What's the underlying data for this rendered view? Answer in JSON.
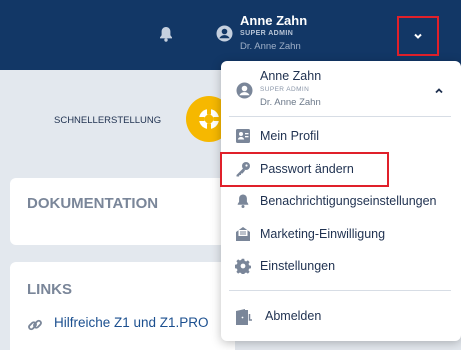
{
  "header": {
    "user_name": "Anne Zahn",
    "user_role": "SUPER ADMIN",
    "user_org": "Dr. Anne Zahn"
  },
  "quick_setup": {
    "label": "SCHNELLERSTELLUNG"
  },
  "cards": {
    "documentation_title": "DOKUMENTATION",
    "links_title": "LINKS",
    "links": [
      "Hilfreiche Z1 und Z1.PRO"
    ]
  },
  "menu": {
    "user_name": "Anne Zahn",
    "user_role": "SUPER ADMIN",
    "user_org": "Dr. Anne Zahn",
    "items": [
      {
        "label": "Mein Profil",
        "icon": "id-card-icon"
      },
      {
        "label": "Passwort ändern",
        "icon": "key-icon"
      },
      {
        "label": "Benachrichtigungseinstellungen",
        "icon": "bell-icon"
      },
      {
        "label": "Marketing-Einwilligung",
        "icon": "envelope-icon"
      },
      {
        "label": "Einstellungen",
        "icon": "gear-icon"
      }
    ],
    "logout_label": "Abmelden"
  },
  "colors": {
    "header_bg": "#123766",
    "accent_yellow": "#f6b800",
    "highlight_red": "#e0202a",
    "text_dark": "#1f3150",
    "link_blue": "#1b4f8f"
  }
}
